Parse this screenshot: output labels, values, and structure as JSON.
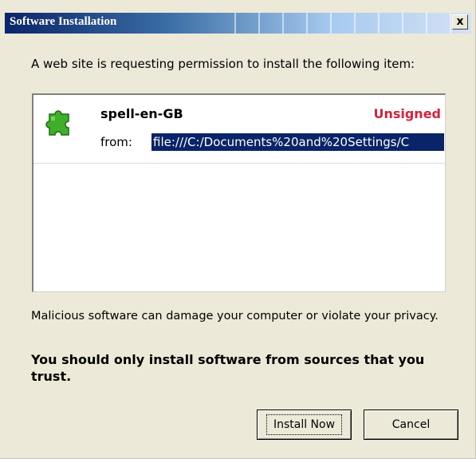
{
  "dialog": {
    "title": "Software Installation",
    "close_label": "x",
    "intro": "A web site is requesting permission to install the following item:"
  },
  "item": {
    "icon": "puzzle-piece-icon",
    "name": "spell-en-GB",
    "status": "Unsigned",
    "from_label": "from:",
    "from_url": "file:///C:/Documents%20and%20Settings/C"
  },
  "messages": {
    "warning": "Malicious software can damage your computer or violate your privacy.",
    "trust": "You should only install software from sources that you trust."
  },
  "buttons": {
    "install": "Install Now",
    "cancel": "Cancel"
  },
  "colors": {
    "title_bar": "#0a246a",
    "unsigned": "#d8213a",
    "selection": "#0a246a",
    "icon_green": "#3fae2a"
  }
}
